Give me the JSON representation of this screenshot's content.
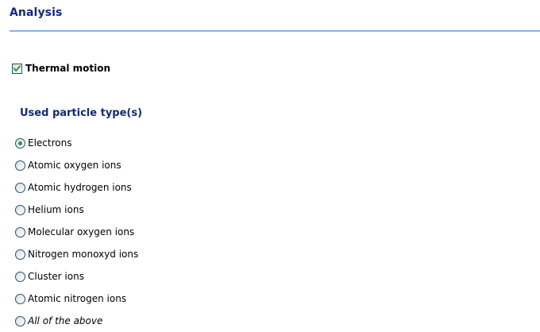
{
  "section": {
    "title": "Analysis"
  },
  "thermal_motion": {
    "label": "Thermal motion",
    "checked": true
  },
  "particle_types": {
    "title": "Used particle type(s)",
    "options": [
      {
        "label": "Electrons",
        "selected": true
      },
      {
        "label": "Atomic oxygen ions",
        "selected": false
      },
      {
        "label": "Atomic hydrogen ions",
        "selected": false
      },
      {
        "label": "Helium ions",
        "selected": false
      },
      {
        "label": "Molecular oxygen ions",
        "selected": false
      },
      {
        "label": "Nitrogen monoxyd ions",
        "selected": false
      },
      {
        "label": "Cluster ions",
        "selected": false
      },
      {
        "label": "Atomic nitrogen ions",
        "selected": false
      },
      {
        "label": "All of the above",
        "selected": false,
        "italic": true
      }
    ]
  },
  "colors": {
    "heading": "#102a7a",
    "separator": "#8db2e6",
    "check_mark": "#21a121",
    "control_border": "#1c5180"
  }
}
